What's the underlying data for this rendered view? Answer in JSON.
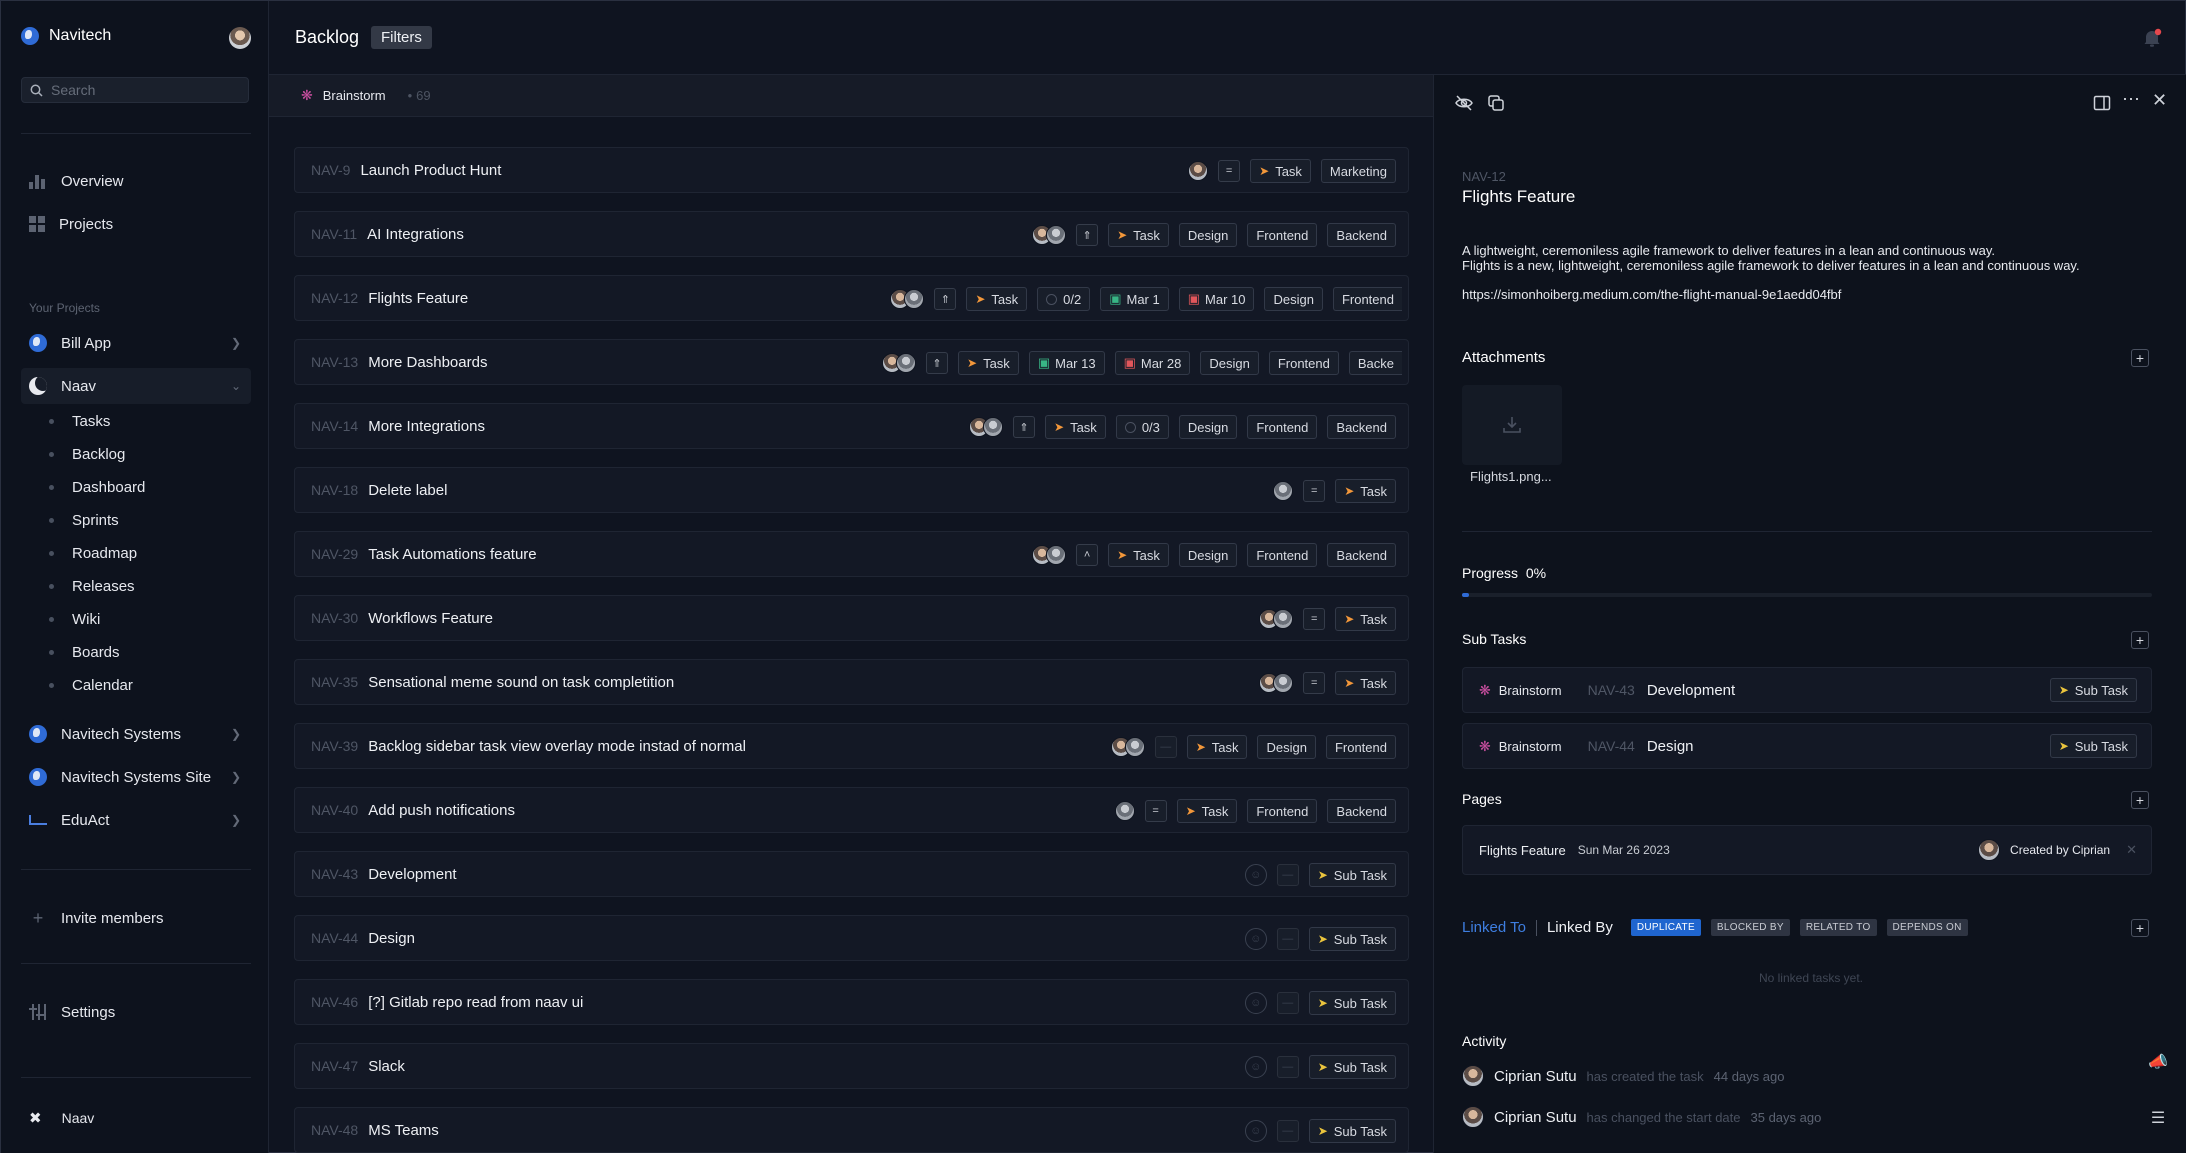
{
  "workspace": {
    "name": "Navitech"
  },
  "search": {
    "placeholder": "Search"
  },
  "nav": {
    "overview": "Overview",
    "projects": "Projects"
  },
  "projects_label": "Your Projects",
  "projects": [
    {
      "name": "Bill App"
    },
    {
      "name": "Naav"
    },
    {
      "name": "Navitech Systems"
    },
    {
      "name": "Navitech Systems Site"
    },
    {
      "name": "EduAct"
    }
  ],
  "naav_menu": [
    "Tasks",
    "Backlog",
    "Dashboard",
    "Sprints",
    "Roadmap",
    "Releases",
    "Wiki",
    "Boards",
    "Calendar"
  ],
  "invite": "Invite members",
  "settings": "Settings",
  "footer_project": "Naav",
  "header": {
    "title": "Backlog",
    "filters": "Filters"
  },
  "group": {
    "name": "Brainstorm",
    "count": "69"
  },
  "rows": [
    {
      "id": "NAV-9",
      "title": "Launch Product Hunt",
      "tags": [
        "Task",
        "Marketing"
      ]
    },
    {
      "id": "NAV-11",
      "title": "AI Integrations",
      "tags": [
        "Task",
        "Design",
        "Frontend",
        "Backend"
      ]
    },
    {
      "id": "NAV-12",
      "title": "Flights Feature",
      "tags": [
        "Task",
        "0/2",
        "Mar 1",
        "Mar 10",
        "Design",
        "Frontend"
      ]
    },
    {
      "id": "NAV-13",
      "title": "More Dashboards",
      "tags": [
        "Task",
        "Mar 13",
        "Mar 28",
        "Design",
        "Frontend",
        "Backe"
      ]
    },
    {
      "id": "NAV-14",
      "title": "More Integrations",
      "tags": [
        "Task",
        "0/3",
        "Design",
        "Frontend",
        "Backend"
      ]
    },
    {
      "id": "NAV-18",
      "title": "Delete label",
      "tags": [
        "Task"
      ]
    },
    {
      "id": "NAV-29",
      "title": "Task Automations feature",
      "tags": [
        "Task",
        "Design",
        "Frontend",
        "Backend"
      ]
    },
    {
      "id": "NAV-30",
      "title": "Workflows Feature",
      "tags": [
        "Task"
      ]
    },
    {
      "id": "NAV-35",
      "title": "Sensational meme sound on task completition",
      "tags": [
        "Task"
      ]
    },
    {
      "id": "NAV-39",
      "title": "Backlog sidebar task view overlay mode instad of normal",
      "tags": [
        "Task",
        "Design",
        "Frontend"
      ]
    },
    {
      "id": "NAV-40",
      "title": "Add push notifications",
      "tags": [
        "Task",
        "Frontend",
        "Backend"
      ]
    },
    {
      "id": "NAV-43",
      "title": "Development",
      "tags": [
        "Sub Task"
      ]
    },
    {
      "id": "NAV-44",
      "title": "Design",
      "tags": [
        "Sub Task"
      ]
    },
    {
      "id": "NAV-46",
      "title": "[?] Gitlab repo read from naav ui",
      "tags": [
        "Sub Task"
      ]
    },
    {
      "id": "NAV-47",
      "title": "Slack",
      "tags": [
        "Sub Task"
      ]
    },
    {
      "id": "NAV-48",
      "title": "MS Teams",
      "tags": [
        "Sub Task"
      ]
    }
  ],
  "detail": {
    "id": "NAV-12",
    "title": "Flights Feature",
    "desc1": "A lightweight, ceremoniless agile framework to deliver features in a lean and continuous way.",
    "desc2": "Flights is a new, lightweight, ceremoniless agile framework to deliver features in a lean and continuous way.",
    "link": "https://simonhoiberg.medium.com/the-flight-manual-9e1aedd04fbf",
    "attachments_label": "Attachments",
    "attachment_name": "Flights1.png...",
    "progress_label": "Progress",
    "progress_value": "0%",
    "progress_fraction": 0.01,
    "subtasks_label": "Sub Tasks",
    "subtasks": [
      {
        "project": "Brainstorm",
        "id": "NAV-43",
        "title": "Development",
        "type": "Sub Task"
      },
      {
        "project": "Brainstorm",
        "id": "NAV-44",
        "title": "Design",
        "type": "Sub Task"
      }
    ],
    "pages_label": "Pages",
    "page": {
      "title": "Flights Feature",
      "date": "Sun Mar 26 2023",
      "created_by": "Created by Ciprian"
    },
    "linked_to": "Linked To",
    "linked_by": "Linked By",
    "link_types": [
      "DUPLICATE",
      "BLOCKED BY",
      "RELATED TO",
      "DEPENDS ON"
    ],
    "no_links": "No linked tasks yet.",
    "activity_label": "Activity",
    "activity": [
      {
        "who": "Ciprian Sutu",
        "what": "has created the task",
        "when": "44 days ago"
      },
      {
        "who": "Ciprian Sutu",
        "what": "has changed the start date",
        "when": "35 days ago"
      }
    ]
  },
  "colors": {
    "accent": "#2f6bd6",
    "task_bolt": "#f2973a",
    "subtask_bolt": "#eac43d",
    "brainstorm": "#c94fa0"
  }
}
